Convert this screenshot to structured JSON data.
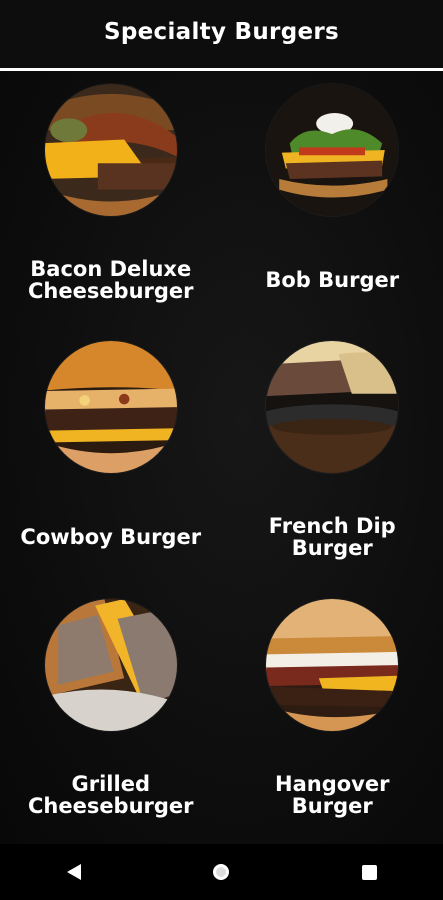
{
  "header": {
    "title": "Specialty Burgers"
  },
  "items": [
    {
      "line1": "Bacon Deluxe",
      "line2": "Cheeseburger",
      "photo": "bacon-deluxe-photo"
    },
    {
      "line1": "Bob Burger",
      "line2": "",
      "photo": "bob-burger-photo"
    },
    {
      "line1": "Cowboy Burger",
      "line2": "",
      "photo": "cowboy-burger-photo"
    },
    {
      "line1": "French Dip",
      "line2": "Burger",
      "photo": "french-dip-photo"
    },
    {
      "line1": "Grilled",
      "line2": "Cheeseburger",
      "photo": "grilled-cheeseburger-photo"
    },
    {
      "line1": "Hangover",
      "line2": "Burger",
      "photo": "hangover-burger-photo"
    }
  ],
  "navbar": {
    "back": "back-icon",
    "home": "home-icon",
    "recents": "recents-icon"
  },
  "colors": {
    "background": "#0d0d0d",
    "text": "#ffffff",
    "divider": "#ffffff",
    "navbar": "#000000"
  }
}
